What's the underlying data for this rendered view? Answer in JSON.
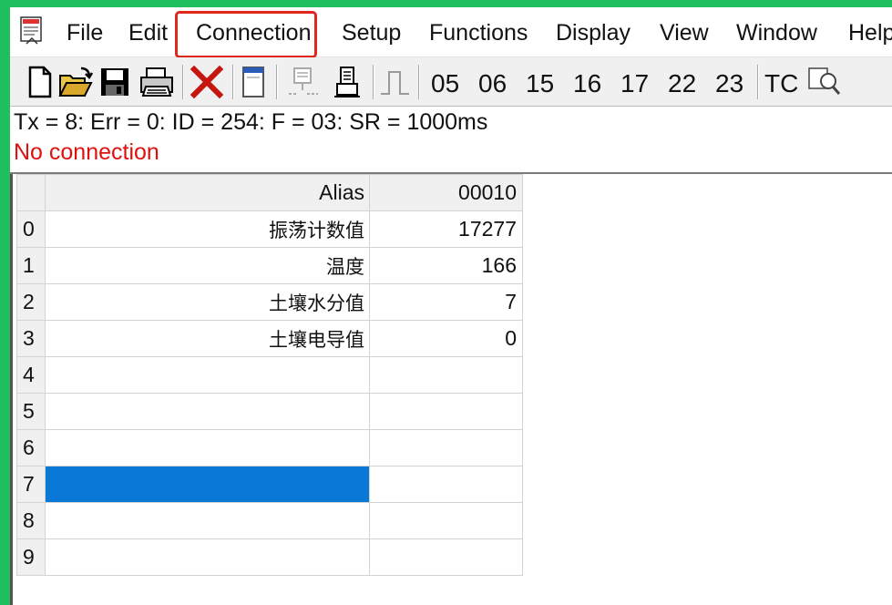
{
  "menu": {
    "items": [
      {
        "label": "File"
      },
      {
        "label": "Edit"
      },
      {
        "label": "Connection"
      },
      {
        "label": "Setup"
      },
      {
        "label": "Functions"
      },
      {
        "label": "Display"
      },
      {
        "label": "View"
      },
      {
        "label": "Window"
      },
      {
        "label": "Help"
      }
    ]
  },
  "toolbar": {
    "function_codes": [
      "05",
      "06",
      "15",
      "16",
      "17",
      "22",
      "23"
    ],
    "tc_label": "TC",
    "icons": [
      "new-file-icon",
      "open-folder-icon",
      "save-icon",
      "print-icon",
      "disconnect-icon",
      "window-icon",
      "connect-icon",
      "serial-icon",
      "pulse-icon",
      "search-icon"
    ]
  },
  "status": {
    "line1": "Tx = 8: Err = 0: ID = 254: F = 03: SR = 1000ms",
    "line2": "No connection",
    "line2_color": "#e0100f"
  },
  "grid": {
    "header": {
      "alias": "Alias",
      "address": "00010"
    },
    "rows": [
      {
        "index": "0",
        "alias": "振荡计数值",
        "value": "17277"
      },
      {
        "index": "1",
        "alias": "温度",
        "value": "166"
      },
      {
        "index": "2",
        "alias": "土壤水分值",
        "value": "7"
      },
      {
        "index": "3",
        "alias": "土壤电导值",
        "value": "0"
      },
      {
        "index": "4",
        "alias": "",
        "value": ""
      },
      {
        "index": "5",
        "alias": "",
        "value": ""
      },
      {
        "index": "6",
        "alias": "",
        "value": ""
      },
      {
        "index": "7",
        "alias": "",
        "value": ""
      },
      {
        "index": "8",
        "alias": "",
        "value": ""
      },
      {
        "index": "9",
        "alias": "",
        "value": ""
      }
    ],
    "selected_row": "7",
    "selection_color": "#0a78d7"
  },
  "colors": {
    "frame": "#1fbf5f",
    "highlight": "#e0261d"
  }
}
